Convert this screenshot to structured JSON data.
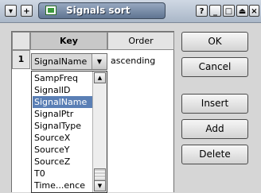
{
  "window": {
    "title": "Signals sort",
    "left_controls": {
      "menu_glyph": "▾",
      "add_glyph": "+"
    },
    "right_controls": {
      "help": "?",
      "minimize": "_",
      "restore": "□",
      "shade": "⏏",
      "close": "×"
    }
  },
  "table": {
    "headers": {
      "key": "Key",
      "order": "Order"
    },
    "rows": [
      {
        "num": "1",
        "key": "SignalName",
        "order": "ascending"
      }
    ]
  },
  "dropdown": {
    "items": [
      "SampFreq",
      "SignalID",
      "SignalName",
      "SignalPtr",
      "SignalType",
      "SourceX",
      "SourceY",
      "SourceZ",
      "T0",
      "Time...ence"
    ],
    "selected_index": 2
  },
  "buttons": {
    "ok": "OK",
    "cancel": "Cancel",
    "insert": "Insert",
    "add": "Add",
    "delete": "Delete"
  }
}
